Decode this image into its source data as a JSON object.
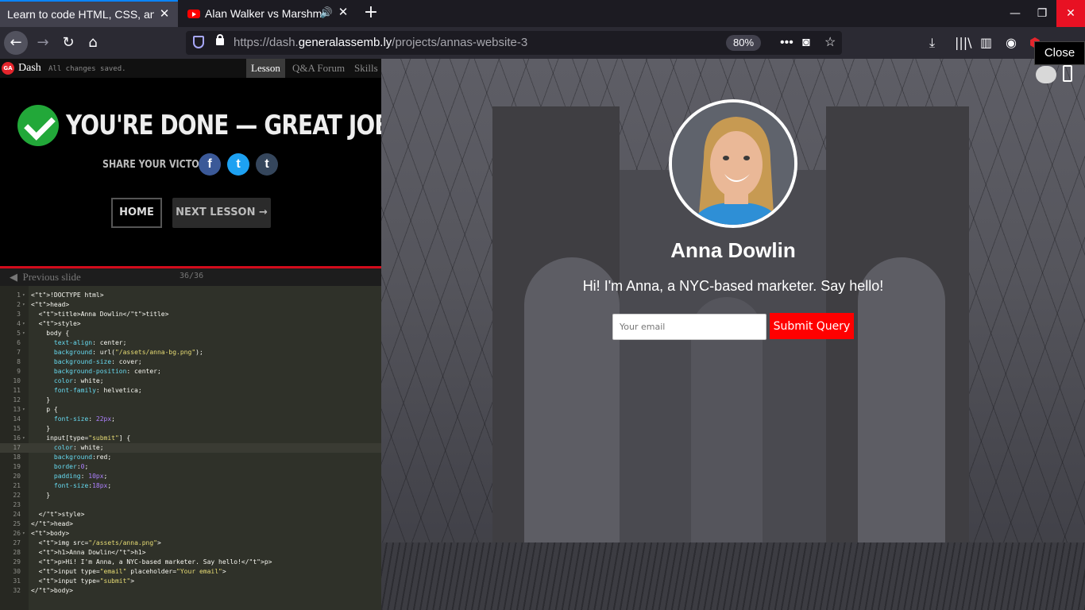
{
  "browser": {
    "tabs": [
      {
        "title": "Learn to code HTML, CSS, and",
        "active": true
      },
      {
        "title": "Alan Walker vs Marshmello",
        "active": false
      }
    ],
    "close_glyph": "✕",
    "new_tab_glyph": "+",
    "url_protocol": "https://dash.",
    "url_domain": "generalassemb.ly",
    "url_path": "/projects/annas-website-3",
    "zoom": "80%",
    "window_controls": {
      "minimize": "—",
      "restore": "❐",
      "close": "✕"
    },
    "nav": {
      "back": "←",
      "forward": "→",
      "reload": "↻",
      "home": "⌂"
    },
    "tooltip": "Close"
  },
  "dash": {
    "logo": "GA",
    "title": "Dash",
    "status": "All changes saved.",
    "tabs": [
      "Lesson",
      "Q&A Forum",
      "Skills"
    ]
  },
  "lesson": {
    "done_title": "YOU'RE DONE — GREAT JOB!",
    "share_label": "SHARE YOUR VICTORY:",
    "share": [
      {
        "name": "facebook",
        "glyph": "f",
        "color": "#3b5998"
      },
      {
        "name": "twitter",
        "glyph": "t",
        "color": "#1da1f2"
      },
      {
        "name": "tumblr",
        "glyph": "t",
        "color": "#35465c"
      }
    ],
    "home_button": "HOME",
    "next_button": "NEXT LESSON →",
    "previous_slide": "Previous slide",
    "slide_count": "36/36"
  },
  "editor": {
    "lines": [
      "<!DOCTYPE html>",
      "<head>",
      "  <title>Anna Dowlin</title>",
      "  <style>",
      "    body {",
      "      text-align: center;",
      "      background: url(\"/assets/anna-bg.png\");",
      "      background-size: cover;",
      "      background-position: center;",
      "      color: white;",
      "      font-family: helvetica;",
      "    }",
      "    p {",
      "      font-size: 22px;",
      "    }",
      "    input[type=\"submit\"] {",
      "      color: white;",
      "      background:red;",
      "      border:0;",
      "      padding: 10px;",
      "      font-size:18px;",
      "    }",
      "",
      "  </style>",
      "</head>",
      "<body>",
      "  <img src=\"/assets/anna.png\">",
      "  <h1>Anna Dowlin</h1>",
      "  <p>Hi! I'm Anna, a NYC-based marketer. Say hello!</p>",
      "  <input type=\"email\" placeholder=\"Your email\">",
      "  <input type=\"submit\">",
      "</body>"
    ],
    "highlight_line": 17
  },
  "preview": {
    "name": "Anna Dowlin",
    "tagline": "Hi! I'm Anna, a NYC-based marketer. Say hello!",
    "email_placeholder": "Your email",
    "submit_label": "Submit Query"
  },
  "colors": {
    "accent_red": "#ff0000",
    "check_green": "#22a839",
    "tab_blue": "#0a84ff"
  }
}
